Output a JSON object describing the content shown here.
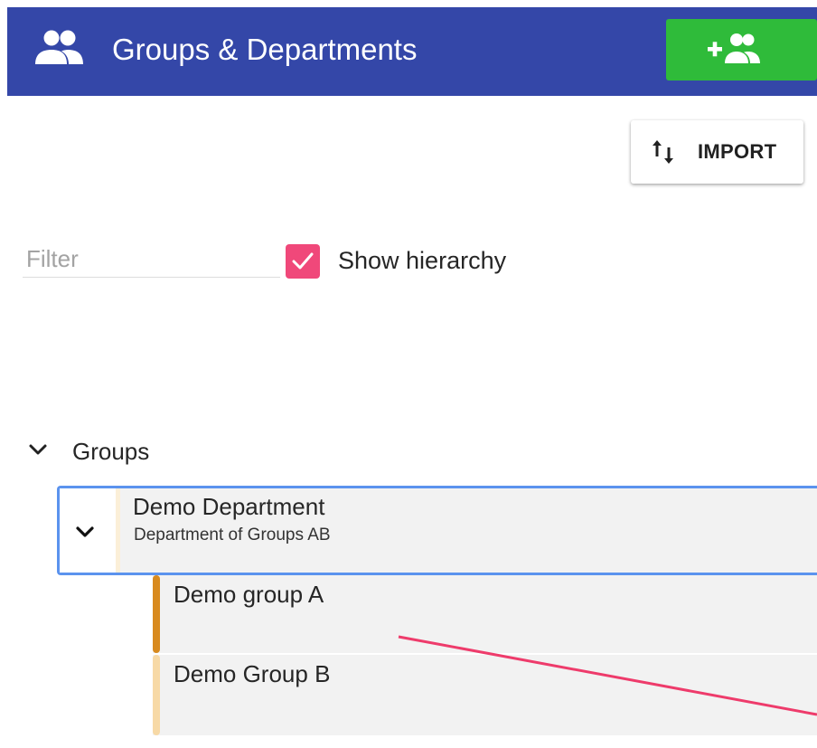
{
  "header": {
    "title": "Groups & Departments",
    "icon": "people-icon",
    "background_color": "#3447a8",
    "add_button_icon": "add-group-icon",
    "add_button_color": "#2fbb3a"
  },
  "toolbar": {
    "import_label": "IMPORT",
    "import_icon": "swap-vertical-icon"
  },
  "filter": {
    "placeholder": "Filter",
    "value": ""
  },
  "hierarchy": {
    "label": "Show hierarchy",
    "checked": true,
    "checkbox_color": "#f0487a"
  },
  "tree": {
    "section_label": "Groups",
    "expanded": true,
    "department": {
      "name": "Demo Department",
      "subtitle": "Department of Groups AB",
      "expanded": true,
      "selected": true,
      "color": "#fbefd8",
      "groups": [
        {
          "name": "Demo group A",
          "color": "#d88a1e"
        },
        {
          "name": "Demo Group B",
          "color": "#f7d9a6"
        }
      ]
    }
  },
  "annotation": {
    "color": "#ee3b6b"
  }
}
